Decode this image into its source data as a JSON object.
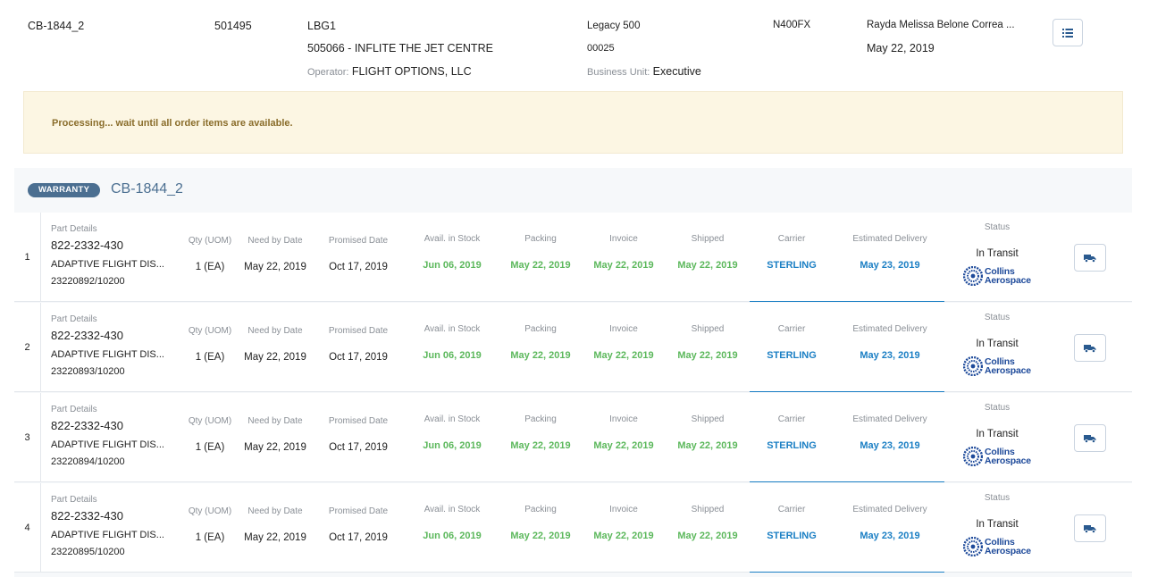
{
  "header": {
    "order_id": "CB-1844_2",
    "account": "501495",
    "station": "LBG1",
    "station_name": "505066 - INFLITE THE JET CENTRE",
    "operator_label": "Operator:",
    "operator_value": "FLIGHT OPTIONS, LLC",
    "aircraft_model": "Legacy 500",
    "serial": "00025",
    "business_unit_label": "Business Unit:",
    "business_unit_value": "Executive",
    "tail": "N400FX",
    "requester": "Rayda Melissa Belone Correa ...",
    "date": "May 22, 2019",
    "list_icon": "list-icon"
  },
  "alert": {
    "message": "Processing... wait until all order items are available."
  },
  "section": {
    "badge": "WARRANTY",
    "title": "CB-1844_2"
  },
  "columns": {
    "part_details": "Part Details",
    "qty": "Qty (UOM)",
    "need_by": "Need by Date",
    "promised": "Promised Date",
    "avail": "Avail. in Stock",
    "packing": "Packing",
    "invoice": "Invoice",
    "shipped": "Shipped",
    "carrier": "Carrier",
    "est_delivery": "Estimated Delivery",
    "status": "Status"
  },
  "items": [
    {
      "num": "1",
      "part_number": "822-2332-430",
      "description": "ADAPTIVE FLIGHT DIS...",
      "po": "23220892/10200",
      "qty": "1 (EA)",
      "need_by": "May 22, 2019",
      "promised": "Oct 17, 2019",
      "avail": "Jun 06, 2019",
      "packing": "May 22, 2019",
      "invoice": "May 22, 2019",
      "shipped": "May 22, 2019",
      "carrier": "STERLING",
      "est_delivery": "May 23, 2019",
      "status": "In Transit",
      "logo_line1": "Collins",
      "logo_line2": "Aerospace"
    },
    {
      "num": "2",
      "part_number": "822-2332-430",
      "description": "ADAPTIVE FLIGHT DIS...",
      "po": "23220893/10200",
      "qty": "1 (EA)",
      "need_by": "May 22, 2019",
      "promised": "Oct 17, 2019",
      "avail": "Jun 06, 2019",
      "packing": "May 22, 2019",
      "invoice": "May 22, 2019",
      "shipped": "May 22, 2019",
      "carrier": "STERLING",
      "est_delivery": "May 23, 2019",
      "status": "In Transit",
      "logo_line1": "Collins",
      "logo_line2": "Aerospace"
    },
    {
      "num": "3",
      "part_number": "822-2332-430",
      "description": "ADAPTIVE FLIGHT DIS...",
      "po": "23220894/10200",
      "qty": "1 (EA)",
      "need_by": "May 22, 2019",
      "promised": "Oct 17, 2019",
      "avail": "Jun 06, 2019",
      "packing": "May 22, 2019",
      "invoice": "May 22, 2019",
      "shipped": "May 22, 2019",
      "carrier": "STERLING",
      "est_delivery": "May 23, 2019",
      "status": "In Transit",
      "logo_line1": "Collins",
      "logo_line2": "Aerospace"
    },
    {
      "num": "4",
      "part_number": "822-2332-430",
      "description": "ADAPTIVE FLIGHT DIS...",
      "po": "23220895/10200",
      "qty": "1 (EA)",
      "need_by": "May 22, 2019",
      "promised": "Oct 17, 2019",
      "avail": "Jun 06, 2019",
      "packing": "May 22, 2019",
      "invoice": "May 22, 2019",
      "shipped": "May 22, 2019",
      "carrier": "STERLING",
      "est_delivery": "May 23, 2019",
      "status": "In Transit",
      "logo_line1": "Collins",
      "logo_line2": "Aerospace"
    }
  ],
  "colors": {
    "accent": "#4b6f91",
    "green": "#5cb85c",
    "blue": "#1b7fc4",
    "alert_bg": "#fcf6e3",
    "alert_text": "#8a6d2b"
  }
}
